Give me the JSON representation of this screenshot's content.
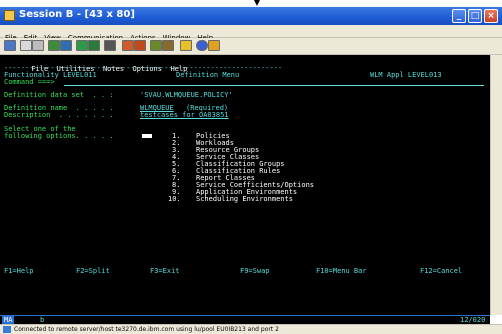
{
  "window": {
    "title": "Session B - [43 x 80]"
  },
  "menubar": {
    "items": [
      "File",
      "Edit",
      "View",
      "Communication",
      "Actions",
      "Window",
      "Help"
    ]
  },
  "toolbar": {
    "icons": [
      "copy",
      "paste",
      "cut",
      "send",
      "receive",
      "display",
      "map",
      "print",
      "find",
      "help",
      "color",
      "macro"
    ]
  },
  "terminal": {
    "action_bar": [
      {
        "label": "File",
        "hotkey": "F"
      },
      {
        "label": "Utilities",
        "hotkey": "U"
      },
      {
        "label": "Notes",
        "hotkey": "N"
      },
      {
        "label": "Options",
        "hotkey": "O"
      },
      {
        "label": "Help",
        "hotkey": "H"
      }
    ],
    "separator": "------------------------------------------------------------------",
    "header_left": "Functionality LEVEL011",
    "header_center": "Definition Menu",
    "header_right": "WLM Appl LEVEL013",
    "command_label": "Command ===>",
    "def_dataset_label": "Definition data set  . . :",
    "def_dataset_value": "'SVAU.WLMQUEUE.POLICY'",
    "def_name_label": "Definition name  . . . . .",
    "def_name_value": "WLMQUEUE",
    "def_name_note": "(Required)",
    "description_label": "Description  . . . . . . .",
    "description_value": "testcases for OA03851",
    "select_line1": "Select one of the",
    "select_line2": "following options. . . . .",
    "options": [
      {
        "num": "1.",
        "label": "Policies"
      },
      {
        "num": "2.",
        "label": "Workloads"
      },
      {
        "num": "3.",
        "label": "Resource Groups"
      },
      {
        "num": "4.",
        "label": "Service Classes"
      },
      {
        "num": "5.",
        "label": "Classification Groups"
      },
      {
        "num": "6.",
        "label": "Classification Rules"
      },
      {
        "num": "7.",
        "label": "Report Classes"
      },
      {
        "num": "8.",
        "label": "Service Coefficients/Options"
      },
      {
        "num": "9.",
        "label": "Application Environments"
      },
      {
        "num": "10.",
        "label": "Scheduling Environments"
      }
    ],
    "function_keys": [
      "F1=Help",
      "F2=Split",
      "F3=Exit",
      "F9=Swap",
      "F10=Menu Bar",
      "F12=Cancel"
    ]
  },
  "oia": {
    "left": "MA",
    "mid": "b",
    "right": "12/020"
  },
  "statusbar": {
    "text": "Connected to remote server/host te3270.de.ibm.com using lu/pool EU0IB213 and port 2"
  },
  "colors": {
    "terminal_bg": "#000000",
    "green": "#35e05a",
    "cyan": "#55dcdc",
    "yellow": "#ffff55",
    "titlebar": "#1d5bd6"
  }
}
